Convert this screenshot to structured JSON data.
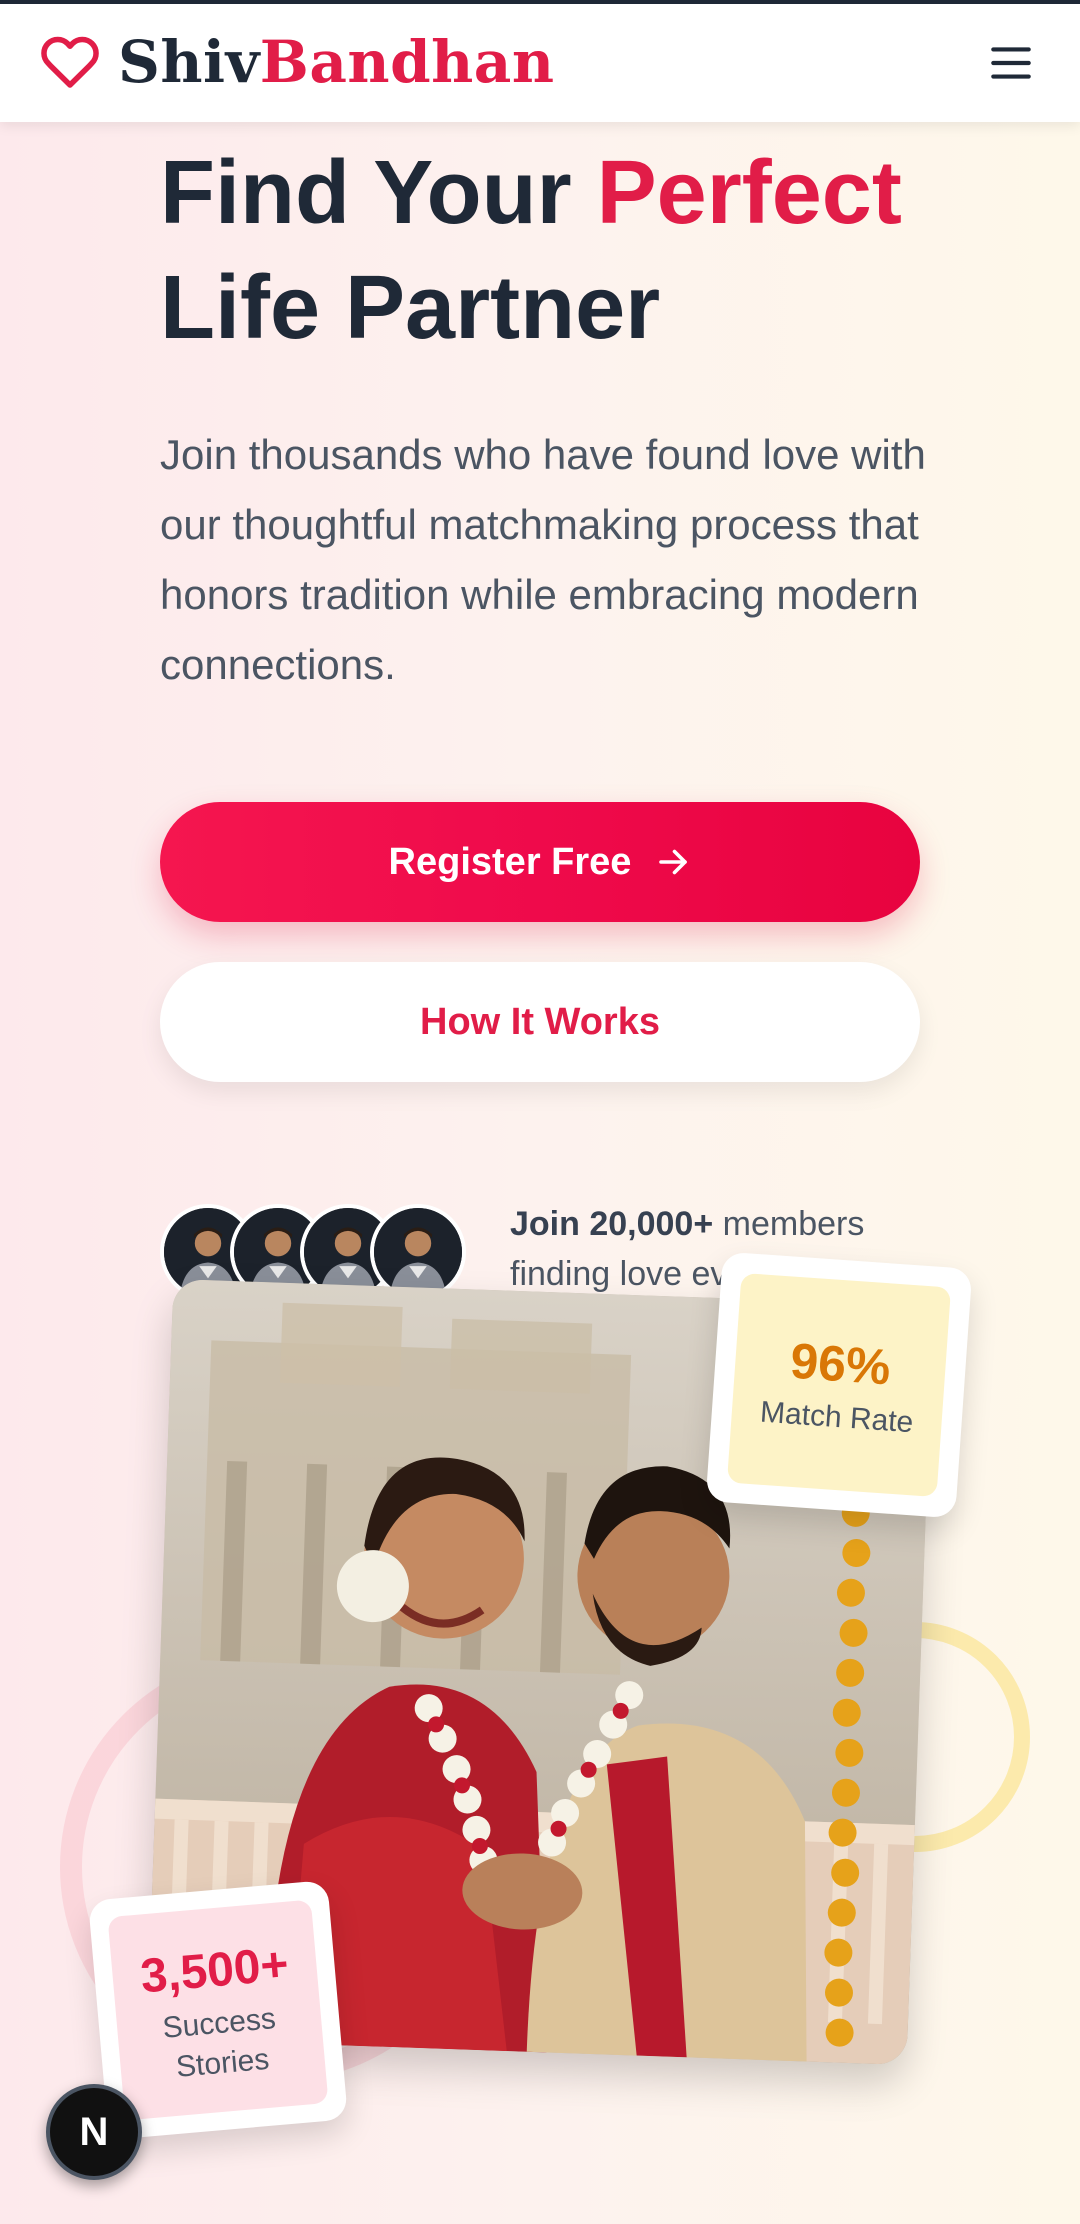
{
  "header": {
    "brand_part1": "Shiv",
    "brand_part2": "Bandhan",
    "logo_icon": "heart-outline-icon",
    "menu_icon": "hamburger-menu-icon",
    "colors": {
      "brand_dark": "#1f2937",
      "brand_accent": "#e11d48"
    }
  },
  "hero": {
    "headline_part1": "Find Your ",
    "headline_accent": "Perfect",
    "headline_part2": "Life Partner",
    "subtext": "Join thousands who have found love with our thoughtful matchmaking process that honors tradition while embracing modern connections.",
    "primary_button_label": "Register Free",
    "primary_button_icon": "arrow-right-icon",
    "secondary_button_label": "How It Works",
    "members_bold": "Join 20,000+",
    "members_rest": " members finding love every day",
    "avatar_count": 4
  },
  "stats": {
    "match_rate_value": "96%",
    "match_rate_label": "Match Rate",
    "success_value": "3,500+",
    "success_label": "Success Stories"
  },
  "badge": {
    "letter": "N"
  }
}
